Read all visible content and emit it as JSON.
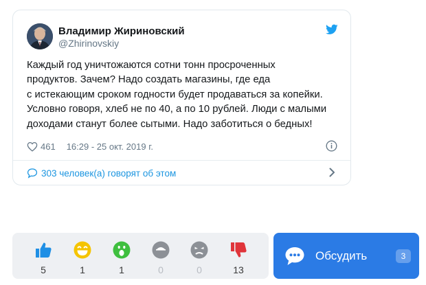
{
  "tweet": {
    "author_name": "Владимир Жириновский",
    "author_handle": "@Zhirinovskiy",
    "text_lines": [
      "Каждый год уничтожаются сотни тонн просроченных",
      "продуктов. Зачем? Надо создать магазины, где еда",
      "с истекающим сроком годности будет продаваться за копейки.",
      "Условно говоря, хлеб не по 40, а по 10 рублей. Люди с малыми",
      "доходами станут более сытыми. Надо заботиться о бедных!"
    ],
    "likes": "461",
    "timestamp": "16:29 - 25 окт. 2019 г.",
    "discussion_link": "303 человек(а) говорят об этом"
  },
  "reactions": [
    {
      "icon": "thumbs-up-icon",
      "count": "5"
    },
    {
      "icon": "laughing-face-icon",
      "count": "1"
    },
    {
      "icon": "surprised-face-icon",
      "count": "1"
    },
    {
      "icon": "sad-face-icon",
      "count": "0"
    },
    {
      "icon": "angry-face-icon",
      "count": "0"
    },
    {
      "icon": "thumbs-down-icon",
      "count": "13"
    }
  ],
  "discuss": {
    "label": "Обсудить",
    "count": "3"
  },
  "colors": {
    "twitter_blue": "#1da1f2",
    "link_blue": "#1b95e0",
    "discuss_button": "#2b7be5",
    "like_blue": "#1f8fe5",
    "laugh_yellow": "#f5c400",
    "wow_green": "#3fbf3f",
    "neutral_gray": "#8c9096",
    "dislike_red": "#e0343a"
  }
}
